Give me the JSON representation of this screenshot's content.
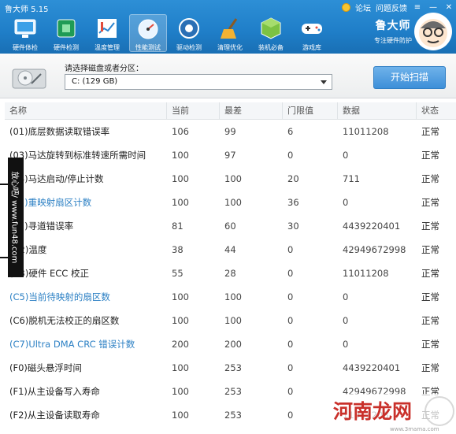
{
  "window": {
    "title": "鲁大师 5.15",
    "links": [
      "论坛",
      "问题反馈"
    ]
  },
  "toolbar": {
    "items": [
      {
        "label": "硬件体检",
        "icon": "monitor-icon"
      },
      {
        "label": "硬件检测",
        "icon": "chip-icon"
      },
      {
        "label": "温度管理",
        "icon": "thermometer-icon"
      },
      {
        "label": "性能测试",
        "icon": "speedometer-icon",
        "active": true
      },
      {
        "label": "驱动检测",
        "icon": "driver-gear-icon"
      },
      {
        "label": "清理优化",
        "icon": "broom-icon"
      },
      {
        "label": "装机必备",
        "icon": "cube-icon"
      },
      {
        "label": "游戏库",
        "icon": "gamepad-icon"
      }
    ]
  },
  "brand": {
    "name": "鲁大师",
    "slogan": "专注硬件防护"
  },
  "disk": {
    "label": "请选择磁盘或者分区：",
    "selected": "C:  (129 GB)"
  },
  "scan_button": "开始扫描",
  "table": {
    "columns": [
      "名称",
      "当前",
      "最差",
      "门限值",
      "数据",
      "状态"
    ],
    "rows": [
      {
        "name": "(01)底层数据读取错误率",
        "cur": "106",
        "worst": "99",
        "thresh": "6",
        "data": "11011208",
        "status": "正常"
      },
      {
        "name": "(03)马达旋转到标准转速所需时间",
        "cur": "100",
        "worst": "97",
        "thresh": "0",
        "data": "0",
        "status": "正常"
      },
      {
        "name": "(04)马达启动/停止计数",
        "cur": "100",
        "worst": "100",
        "thresh": "20",
        "data": "711",
        "status": "正常"
      },
      {
        "name": "(05)重映射扇区计数",
        "cur": "100",
        "worst": "100",
        "thresh": "36",
        "data": "0",
        "status": "正常",
        "highlight": true
      },
      {
        "name": "(07)寻道错误率",
        "cur": "81",
        "worst": "60",
        "thresh": "30",
        "data": "4439220401",
        "status": "正常"
      },
      {
        "name": "(C2)温度",
        "cur": "38",
        "worst": "44",
        "thresh": "0",
        "data": "42949672998",
        "status": "正常"
      },
      {
        "name": "(C3)硬件 ECC 校正",
        "cur": "55",
        "worst": "28",
        "thresh": "0",
        "data": "11011208",
        "status": "正常"
      },
      {
        "name": "(C5)当前待映射的扇区数",
        "cur": "100",
        "worst": "100",
        "thresh": "0",
        "data": "0",
        "status": "正常",
        "highlight": true
      },
      {
        "name": "(C6)脱机无法校正的扇区数",
        "cur": "100",
        "worst": "100",
        "thresh": "0",
        "data": "0",
        "status": "正常"
      },
      {
        "name": "(C7)Ultra DMA CRC 错误计数",
        "cur": "200",
        "worst": "200",
        "thresh": "0",
        "data": "0",
        "status": "正常",
        "highlight": true
      },
      {
        "name": "(F0)磁头悬浮时间",
        "cur": "100",
        "worst": "253",
        "thresh": "0",
        "data": "4439220401",
        "status": "正常"
      },
      {
        "name": "(F1)从主设备写入寿命",
        "cur": "100",
        "worst": "253",
        "thresh": "0",
        "data": "42949672998",
        "status": "正常"
      },
      {
        "name": "(F2)从主设备读取寿命",
        "cur": "100",
        "worst": "253",
        "thresh": "0",
        "data": "11011208",
        "status": "正常"
      }
    ]
  },
  "overlay": {
    "side_watermark": "放心吧/ www.fun48.com",
    "corner_watermark": "河南龙网",
    "corner_url": "www.3mama.com"
  }
}
